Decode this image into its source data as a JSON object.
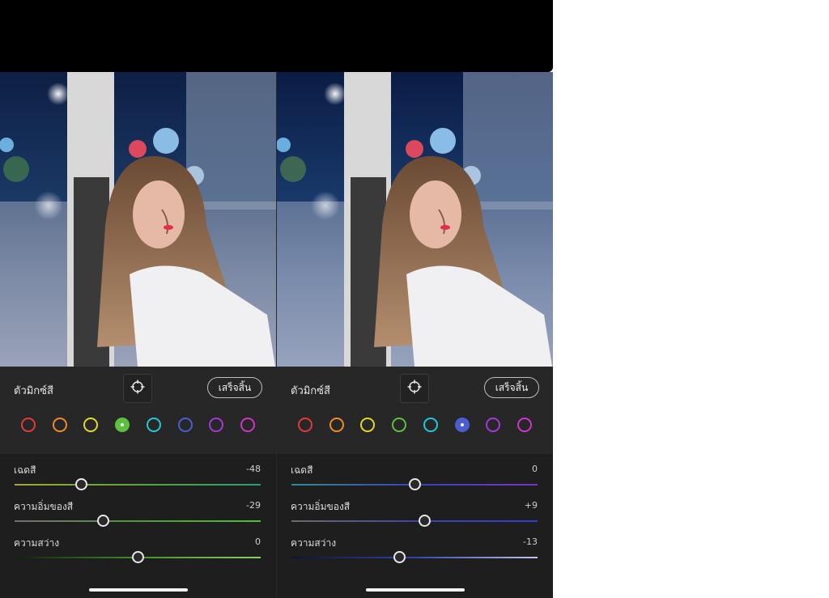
{
  "panels": [
    {
      "title": "ตัวมิกซ์สี",
      "done_label": "เสร็จสิ้น",
      "selected_swatch": 3,
      "swatches": [
        {
          "name": "red",
          "color": "#e03a3a"
        },
        {
          "name": "orange",
          "color": "#ee8a2a"
        },
        {
          "name": "yellow",
          "color": "#e6d626"
        },
        {
          "name": "green",
          "color": "#5cc03c"
        },
        {
          "name": "aqua",
          "color": "#22c8d6"
        },
        {
          "name": "blue",
          "color": "#4a5ed0"
        },
        {
          "name": "purple",
          "color": "#a438d8"
        },
        {
          "name": "magenta",
          "color": "#d234c8"
        }
      ],
      "sliders": [
        {
          "label": "เฉดสี",
          "value": "-48",
          "level": 0.27,
          "gradient": [
            "#a6a637",
            "#56a63a",
            "#2e9a7a"
          ]
        },
        {
          "label": "ความอิ่มของสี",
          "value": "-29",
          "level": 0.36,
          "gradient": [
            "#707070",
            "#4f9a36",
            "#4cc232"
          ]
        },
        {
          "label": "ความสว่าง",
          "value": "0",
          "level": 0.5,
          "gradient": [
            "#141f0e",
            "#3f8f2a",
            "#8ad06a"
          ]
        }
      ]
    },
    {
      "title": "ตัวมิกซ์สี",
      "done_label": "เสร็จสิ้น",
      "selected_swatch": 5,
      "swatches": [
        {
          "name": "red",
          "color": "#e03a3a"
        },
        {
          "name": "orange",
          "color": "#ee8a2a"
        },
        {
          "name": "yellow",
          "color": "#e6d626"
        },
        {
          "name": "green",
          "color": "#5cc03c"
        },
        {
          "name": "aqua",
          "color": "#22c8d6"
        },
        {
          "name": "blue",
          "color": "#4a5ed0"
        },
        {
          "name": "purple",
          "color": "#a438d8"
        },
        {
          "name": "magenta",
          "color": "#d234c8"
        }
      ],
      "sliders": [
        {
          "label": "เฉดสี",
          "value": "0",
          "level": 0.5,
          "gradient": [
            "#2f8a9a",
            "#3844b8",
            "#7a32c8"
          ]
        },
        {
          "label": "ความอิ่มของสี",
          "value": "+9",
          "level": 0.54,
          "gradient": [
            "#6a6a6a",
            "#3c48a8",
            "#2c40d8"
          ]
        },
        {
          "label": "ความสว่าง",
          "value": "-13",
          "level": 0.44,
          "gradient": [
            "#0e1230",
            "#3344aa",
            "#bfc4ea"
          ]
        }
      ]
    }
  ]
}
